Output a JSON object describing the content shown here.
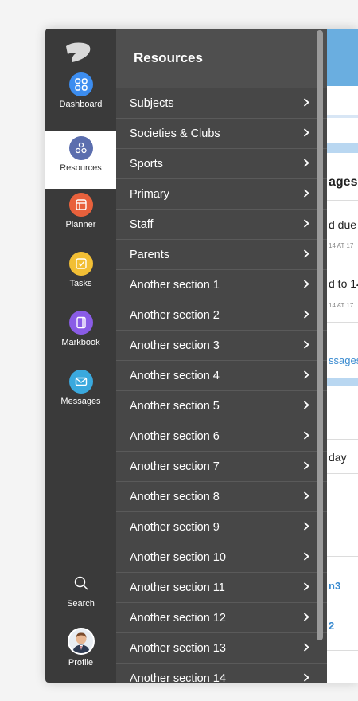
{
  "nav": {
    "items": [
      {
        "label": "Dashboard",
        "icon": "dashboard-grid-icon",
        "color": "#3c8df0"
      },
      {
        "label": "Resources",
        "icon": "resources-icon",
        "color": "#5b6eae"
      },
      {
        "label": "Planner",
        "icon": "planner-icon",
        "color": "#e8613c"
      },
      {
        "label": "Tasks",
        "icon": "tasks-checkbox-icon",
        "color": "#f2bf35"
      },
      {
        "label": "Markbook",
        "icon": "markbook-icon",
        "color": "#8a5ce6"
      },
      {
        "label": "Messages",
        "icon": "envelope-icon",
        "color": "#3aa9de"
      }
    ],
    "active": "Resources",
    "search_label": "Search",
    "profile_label": "Profile"
  },
  "panel": {
    "title": "Resources",
    "items": [
      "Subjects",
      "Societies & Clubs",
      "Sports",
      "Primary",
      "Staff",
      "Parents",
      "Another section 1",
      "Another section 2",
      "Another section 3",
      "Another section 4",
      "Another section 5",
      "Another section 6",
      "Another section 7",
      "Another section 8",
      "Another section 9",
      "Another section 10",
      "Another section 11",
      "Another section 12",
      "Another section 13",
      "Another section 14"
    ]
  },
  "background": {
    "heading": "ages",
    "line1": "d due",
    "time1": "14 AT 17",
    "line2": "d to 14",
    "time2": "14 AT 17",
    "link": "ssages",
    "day": "day",
    "link2": "n3",
    "link3": "2"
  }
}
